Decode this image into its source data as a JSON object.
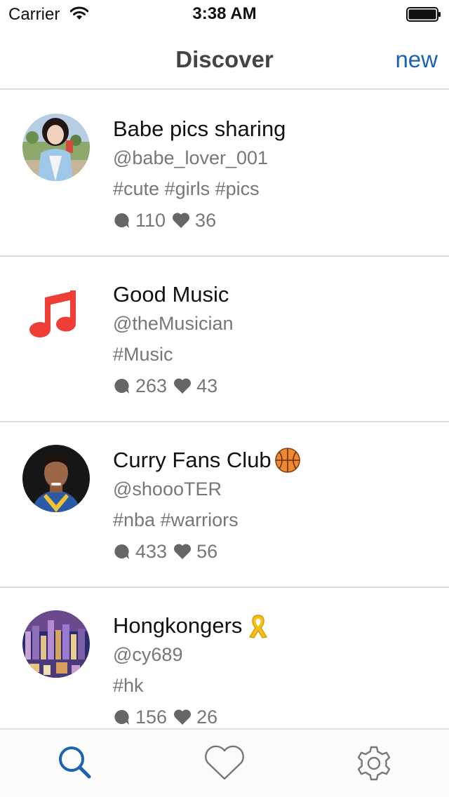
{
  "status_bar": {
    "carrier": "Carrier",
    "time": "3:38 AM"
  },
  "nav": {
    "title": "Discover",
    "new_label": "new"
  },
  "colors": {
    "accent": "#1a63b0",
    "music": "#ef3e36",
    "secondary_text": "#777777"
  },
  "feed": [
    {
      "name": "Babe pics sharing",
      "handle": "@babe_lover_001",
      "tags": "#cute #girls #pics",
      "comments": "110",
      "likes": "36",
      "avatar": "photo-avatar"
    },
    {
      "name": "Good Music",
      "handle": "@theMusician",
      "tags": "#Music",
      "comments": "263",
      "likes": "43",
      "avatar": "music-note-icon"
    },
    {
      "name": "Curry Fans Club",
      "emoji": "basketball",
      "handle": "@shoooTER",
      "tags": "#nba #warriors",
      "comments": "433",
      "likes": "56",
      "avatar": "photo-avatar"
    },
    {
      "name": "Hongkongers",
      "emoji": "yellow-ribbon",
      "handle": "@cy689",
      "tags": "#hk",
      "comments": "156",
      "likes": "26",
      "avatar": "photo-avatar"
    }
  ],
  "tabs": [
    {
      "icon": "search-icon",
      "active": true
    },
    {
      "icon": "heart-icon",
      "active": false
    },
    {
      "icon": "gear-icon",
      "active": false
    }
  ]
}
